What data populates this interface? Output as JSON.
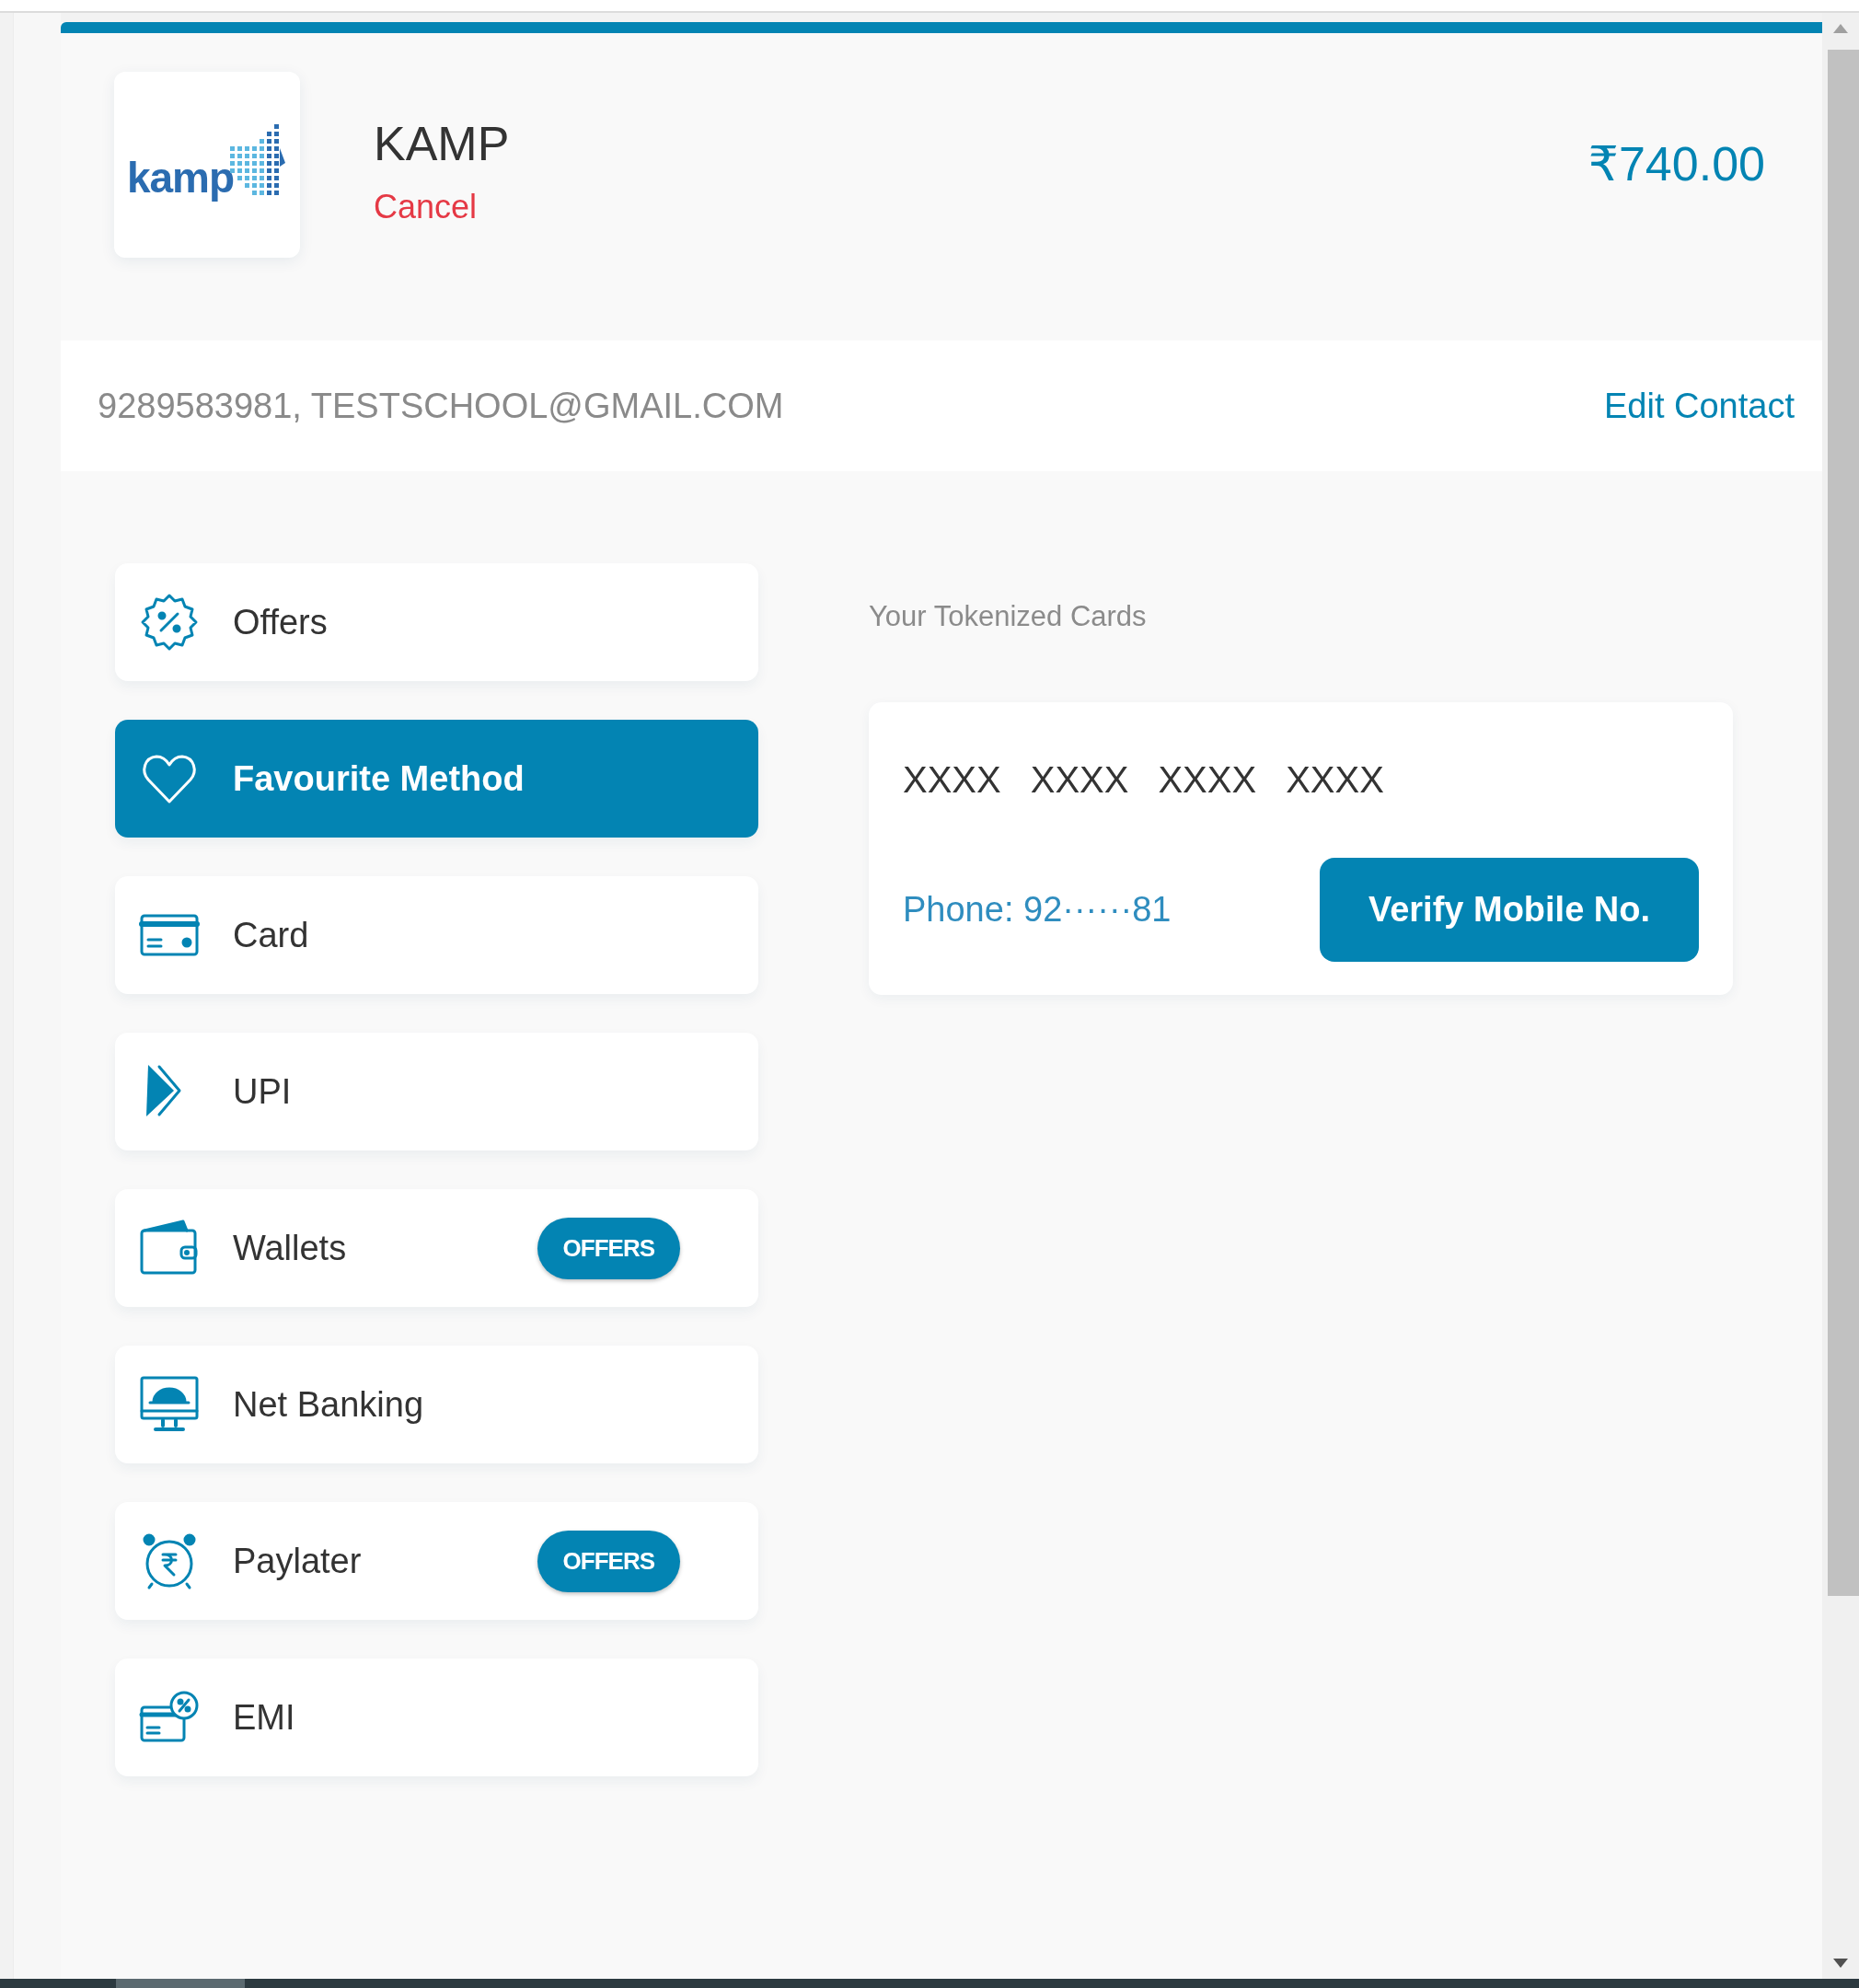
{
  "merchant": {
    "logo_text": "kamp",
    "name": "KAMP",
    "cancel": "Cancel",
    "amount": "₹740.00"
  },
  "contact": {
    "details": "9289583981, TESTSCHOOL@GMAIL.COM",
    "edit": "Edit Contact"
  },
  "methods": [
    {
      "kind": "offers",
      "label": "Offers",
      "selected": false
    },
    {
      "kind": "favourite",
      "label": "Favourite Method",
      "selected": true
    },
    {
      "kind": "card",
      "label": "Card",
      "selected": false
    },
    {
      "kind": "upi",
      "label": "UPI",
      "selected": false
    },
    {
      "kind": "wallet",
      "label": "Wallets",
      "selected": false,
      "badge": "OFFERS"
    },
    {
      "kind": "netbanking",
      "label": "Net Banking",
      "selected": false
    },
    {
      "kind": "paylater",
      "label": "Paylater",
      "selected": false,
      "badge": "OFFERS"
    },
    {
      "kind": "emi",
      "label": "EMI",
      "selected": false
    }
  ],
  "tokenized": {
    "title": "Your Tokenized Cards",
    "card_groups": [
      "XXXX",
      "XXXX",
      "XXXX",
      "XXXX"
    ],
    "phone": "Phone: 92······81",
    "button": "Verify Mobile No."
  }
}
